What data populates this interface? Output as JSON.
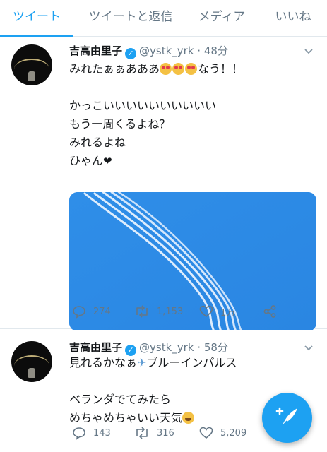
{
  "tabs": [
    {
      "label": "ツイート",
      "active": true
    },
    {
      "label": "ツイートと返信",
      "active": false
    },
    {
      "label": "メディア",
      "active": false
    },
    {
      "label": "いいね",
      "active": false
    }
  ],
  "colors": {
    "accent": "#1da1f2",
    "muted": "#657786",
    "text": "#14171a",
    "sky": "#2f8ee8"
  },
  "tweets": [
    {
      "name": "吉高由里子",
      "verified_icon": "verified-badge-icon",
      "handle": "@ystk_yrk",
      "separator": "·",
      "time": "48分",
      "lines": [
        "みれたぁぁあああ",
        "なう！！",
        "かっこいいいいいいいいいい",
        "もう一周くるよね？",
        "みれるよね",
        "ひゃん"
      ],
      "heart_glyph": "❤",
      "reply_count": "274",
      "retweet_count": "1,153",
      "like_count": "1万",
      "has_media": true
    },
    {
      "name": "吉高由里子",
      "verified_icon": "verified-badge-icon",
      "handle": "@ystk_yrk",
      "separator": "·",
      "time": "58分",
      "lines": [
        "見れるかなぁ",
        "ブルーインパルス",
        "ベランダでてみたら",
        "めちゃめちゃいい天気"
      ],
      "plane_glyph": "✈",
      "reply_count": "143",
      "retweet_count": "316",
      "like_count": "5,209"
    }
  ],
  "fab": {
    "icon": "compose-tweet-icon"
  }
}
